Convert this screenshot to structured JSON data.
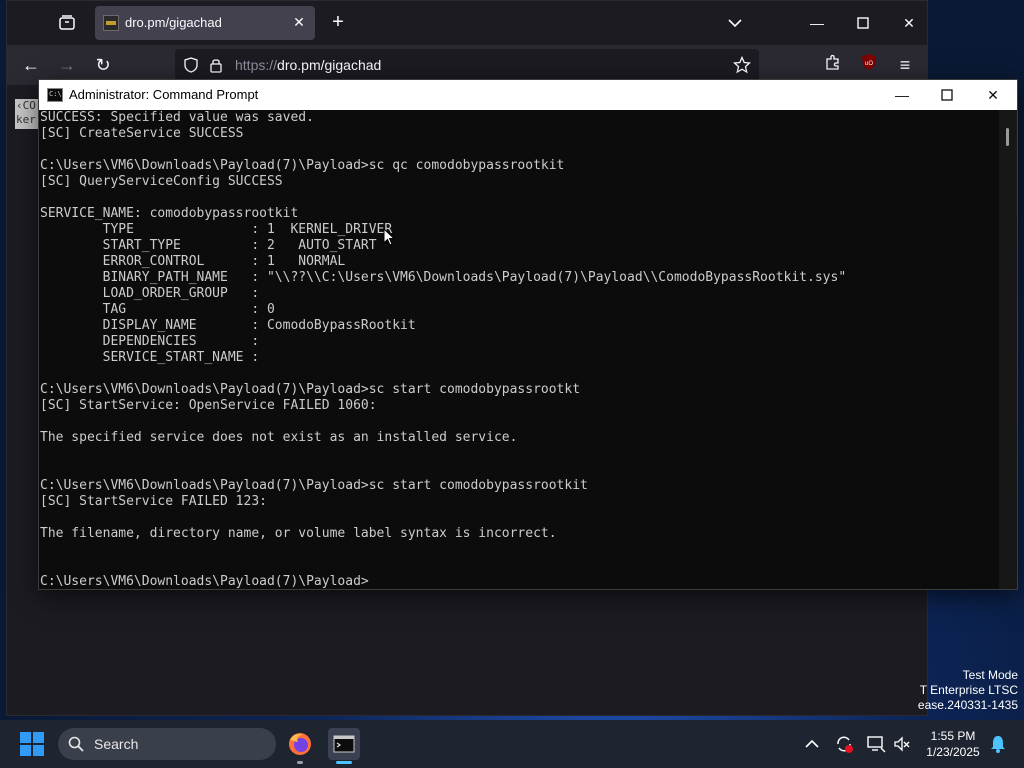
{
  "browser": {
    "tab_title": "dro.pm/gigachad",
    "url_scheme": "https://",
    "url_host": "dro.pm",
    "url_path": "/gigachad",
    "selected_snippet": "‹CO ker"
  },
  "cmd": {
    "title": "Administrator: Command Prompt",
    "icon_text": "C:\\",
    "lines": [
      "SUCCESS: Specified value was saved.",
      "[SC] CreateService SUCCESS",
      "",
      "C:\\Users\\VM6\\Downloads\\Payload(7)\\Payload>sc qc comodobypassrootkit",
      "[SC] QueryServiceConfig SUCCESS",
      "",
      "SERVICE_NAME: comodobypassrootkit",
      "        TYPE               : 1  KERNEL_DRIVER",
      "        START_TYPE         : 2   AUTO_START",
      "        ERROR_CONTROL      : 1   NORMAL",
      "        BINARY_PATH_NAME   : \"\\\\??\\\\C:\\Users\\VM6\\Downloads\\Payload(7)\\Payload\\\\ComodoBypassRootkit.sys\"",
      "        LOAD_ORDER_GROUP   :",
      "        TAG                : 0",
      "        DISPLAY_NAME       : ComodoBypassRootkit",
      "        DEPENDENCIES       :",
      "        SERVICE_START_NAME :",
      "",
      "C:\\Users\\VM6\\Downloads\\Payload(7)\\Payload>sc start comodobypassrootkt",
      "[SC] StartService: OpenService FAILED 1060:",
      "",
      "The specified service does not exist as an installed service.",
      "",
      "",
      "C:\\Users\\VM6\\Downloads\\Payload(7)\\Payload>sc start comodobypassrootkit",
      "[SC] StartService FAILED 123:",
      "",
      "The filename, directory name, or volume label syntax is incorrect.",
      "",
      "",
      "C:\\Users\\VM6\\Downloads\\Payload(7)\\Payload>"
    ]
  },
  "desktop": {
    "watermark_line1": "Test Mode",
    "watermark_line2": "T Enterprise LTSC",
    "watermark_line3": "ease.240331-1435"
  },
  "taskbar": {
    "search_label": "Search",
    "time": "1:55 PM",
    "date": "1/23/2025"
  },
  "colors": {
    "terminal_text": "#cccccc",
    "terminal_bg": "#0c0c0c",
    "taskbar_bg": "#1f2431",
    "windows_accent": "#2f9bf7"
  }
}
